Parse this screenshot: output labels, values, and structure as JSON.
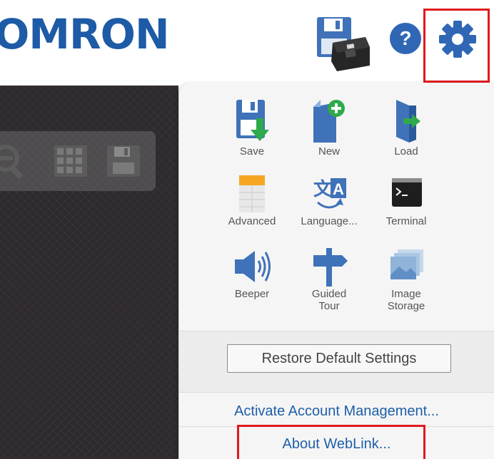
{
  "header": {
    "logo_text": "OMRON",
    "icons": [
      "device-save-icon",
      "help-icon",
      "gear-icon"
    ]
  },
  "viewer": {
    "toolbar_icons": [
      "zoom-out-icon",
      "grid-icon",
      "save-icon"
    ]
  },
  "menu": {
    "tiles": [
      {
        "label": "Save",
        "icon": "save-icon"
      },
      {
        "label": "New",
        "icon": "new-icon"
      },
      {
        "label": "Load",
        "icon": "load-icon"
      },
      {
        "label": "Advanced",
        "icon": "advanced-icon"
      },
      {
        "label": "Language...",
        "icon": "language-icon"
      },
      {
        "label": "Terminal",
        "icon": "terminal-icon"
      },
      {
        "label": "Beeper",
        "icon": "beeper-icon"
      },
      {
        "label": "Guided\nTour",
        "icon": "guided-tour-icon"
      },
      {
        "label": "Image\nStorage",
        "icon": "image-storage-icon"
      }
    ],
    "restore_label": "Restore Default Settings",
    "activate_label": "Activate Account Management...",
    "about_label": "About WebLink..."
  },
  "colors": {
    "brand_blue": "#1d5ba6",
    "link_blue": "#1f5fa8",
    "highlight_red": "#e0191c",
    "accent_green": "#2eaa4a"
  }
}
